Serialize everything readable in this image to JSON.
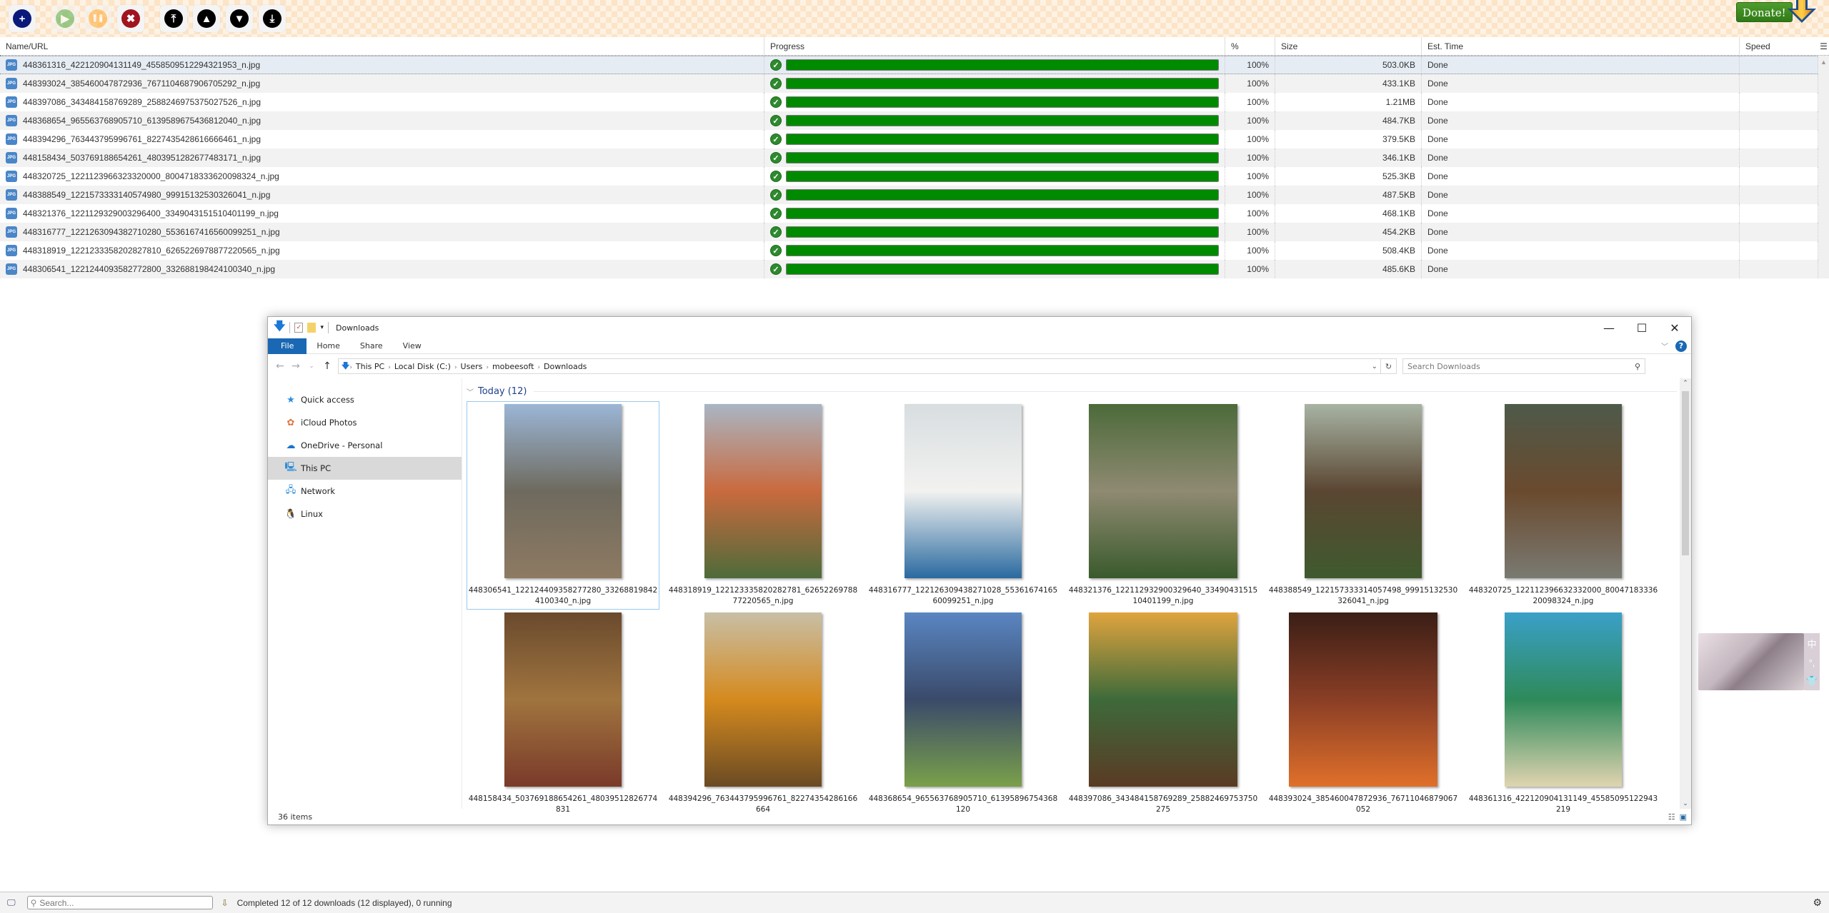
{
  "toolbar": {
    "buttons": [
      {
        "name": "add",
        "icon": "plus-icon",
        "color": "#0a1a7a",
        "glyph": "+",
        "enabled": true
      },
      {
        "name": "start",
        "icon": "play-icon",
        "color": "#3da83d",
        "glyph": "▶",
        "enabled": false
      },
      {
        "name": "pause",
        "icon": "pause-icon",
        "color": "#ffa21f",
        "glyph": "❚❚",
        "enabled": false
      },
      {
        "name": "delete",
        "icon": "x-icon",
        "color": "#a0141e",
        "glyph": "✖",
        "enabled": true
      },
      {
        "name": "move-top",
        "icon": "move-top-icon",
        "color": "#000000",
        "glyph": "⤒",
        "enabled": true
      },
      {
        "name": "move-up",
        "icon": "move-up-icon",
        "color": "#000000",
        "glyph": "▲",
        "enabled": true
      },
      {
        "name": "move-down",
        "icon": "move-down-icon",
        "color": "#000000",
        "glyph": "▼",
        "enabled": true
      },
      {
        "name": "move-bottom",
        "icon": "move-bottom-icon",
        "color": "#000000",
        "glyph": "⤓",
        "enabled": true
      }
    ],
    "donate_label": "Donate!"
  },
  "grid": {
    "columns": {
      "name": "Name/URL",
      "progress": "Progress",
      "percent": "%",
      "size": "Size",
      "est_time": "Est. Time",
      "speed": "Speed"
    },
    "rows": [
      {
        "name": "448361316_422120904131149_4558509512294321953_n.jpg",
        "progress": 1.0,
        "percent": "100%",
        "size": "503.0KB",
        "est_time": "Done",
        "speed": "",
        "selected": true
      },
      {
        "name": "448393024_385460047872936_7671104687906705292_n.jpg",
        "progress": 1.0,
        "percent": "100%",
        "size": "433.1KB",
        "est_time": "Done",
        "speed": ""
      },
      {
        "name": "448397086_343484158769289_2588246975375027526_n.jpg",
        "progress": 1.0,
        "percent": "100%",
        "size": "1.21MB",
        "est_time": "Done",
        "speed": ""
      },
      {
        "name": "448368654_965563768905710_6139589675436812040_n.jpg",
        "progress": 1.0,
        "percent": "100%",
        "size": "484.7KB",
        "est_time": "Done",
        "speed": ""
      },
      {
        "name": "448394296_763443795996761_8227435428616666461_n.jpg",
        "progress": 1.0,
        "percent": "100%",
        "size": "379.5KB",
        "est_time": "Done",
        "speed": ""
      },
      {
        "name": "448158434_503769188654261_4803951282677483171_n.jpg",
        "progress": 1.0,
        "percent": "100%",
        "size": "346.1KB",
        "est_time": "Done",
        "speed": ""
      },
      {
        "name": "448320725_1221123966323320000_8004718333620098324_n.jpg",
        "progress": 1.0,
        "percent": "100%",
        "size": "525.3KB",
        "est_time": "Done",
        "speed": ""
      },
      {
        "name": "448388549_1221573333140574980_99915132530326041_n.jpg",
        "progress": 1.0,
        "percent": "100%",
        "size": "487.5KB",
        "est_time": "Done",
        "speed": ""
      },
      {
        "name": "448321376_1221129329003296400_3349043151510401199_n.jpg",
        "progress": 1.0,
        "percent": "100%",
        "size": "468.1KB",
        "est_time": "Done",
        "speed": ""
      },
      {
        "name": "448316777_1221263094382710280_5536167416560099251_n.jpg",
        "progress": 1.0,
        "percent": "100%",
        "size": "454.2KB",
        "est_time": "Done",
        "speed": ""
      },
      {
        "name": "448318919_1221233358202827810_6265226978877220565_n.jpg",
        "progress": 1.0,
        "percent": "100%",
        "size": "508.4KB",
        "est_time": "Done",
        "speed": ""
      },
      {
        "name": "448306541_1221244093582772800_332688198424100340_n.jpg",
        "progress": 1.0,
        "percent": "100%",
        "size": "485.6KB",
        "est_time": "Done",
        "speed": ""
      }
    ]
  },
  "explorer": {
    "title": "Downloads",
    "ribbon_tabs": [
      "File",
      "Home",
      "Share",
      "View"
    ],
    "breadcrumb": [
      "This PC",
      "Local Disk (C:)",
      "Users",
      "mobeesoft",
      "Downloads"
    ],
    "search_placeholder": "Search Downloads",
    "nav": [
      {
        "label": "Quick access",
        "icon": "star-icon",
        "glyph": "★",
        "color": "#2b8be0"
      },
      {
        "label": "iCloud Photos",
        "icon": "icloud-photos-icon",
        "glyph": "✿",
        "color": "#e0743a"
      },
      {
        "label": "OneDrive - Personal",
        "icon": "onedrive-icon",
        "glyph": "☁",
        "color": "#1a73c9"
      },
      {
        "label": "This PC",
        "icon": "computer-icon",
        "glyph": "🖳",
        "color": "#2a8ad8",
        "selected": true
      },
      {
        "label": "Network",
        "icon": "network-icon",
        "glyph": "🖧",
        "color": "#2a8ad8"
      },
      {
        "label": "Linux",
        "icon": "linux-penguin-icon",
        "glyph": "🐧",
        "color": "#333333"
      }
    ],
    "group_label": "Today (12)",
    "files": [
      {
        "label": "448306541_122124409358277280_332688198424100340_n.jpg",
        "colors": [
          "#9bb6d6",
          "#6e6a5e",
          "#8e7a62"
        ],
        "selected": true
      },
      {
        "label": "448318919_122123335820282781_6265226978877220565_n.jpg",
        "colors": [
          "#a9b6c4",
          "#c96a3e",
          "#4e6b3a"
        ]
      },
      {
        "label": "448316777_122126309438271028_5536167416560099251_n.jpg",
        "colors": [
          "#d8dde0",
          "#f2f2f0",
          "#2a6aa0"
        ]
      },
      {
        "label": "448321376_122112932900329640_3349043151510401199_n.jpg",
        "colors": [
          "#4c6a3a",
          "#8f8a72",
          "#3a5a2c"
        ]
      },
      {
        "label": "448388549_122157333314057498_99915132530326041_n.jpg",
        "colors": [
          "#a8b4a4",
          "#5a4632",
          "#3f5a2e"
        ]
      },
      {
        "label": "448320725_122112396632332000_8004718333620098324_n.jpg",
        "colors": [
          "#4e5a4a",
          "#6a4a2e",
          "#7a7a72"
        ]
      },
      {
        "label": "448158434_503769188654261_48039512826774831",
        "colors": [
          "#6a4a2e",
          "#a0743e",
          "#7a3a2a"
        ]
      },
      {
        "label": "448394296_763443795996761_82274354286166664",
        "colors": [
          "#c8bfa6",
          "#d58a1e",
          "#6a4a24"
        ]
      },
      {
        "label": "448368654_965563768905710_61395896754368120",
        "colors": [
          "#5a86c2",
          "#3a4a6a",
          "#7aa04a"
        ]
      },
      {
        "label": "448397086_343484158769289_25882469753750275",
        "colors": [
          "#e0a43e",
          "#3e6a3a",
          "#5a3a24"
        ]
      },
      {
        "label": "448393024_385460047872936_76711046879067052",
        "colors": [
          "#3a1e16",
          "#8a3e26",
          "#e0702a"
        ]
      },
      {
        "label": "448361316_422120904131149_45585095122943219",
        "colors": [
          "#3aa0c8",
          "#2e8a5a",
          "#e0d4b0"
        ]
      }
    ],
    "item_count": "36 items"
  },
  "widget": {
    "glyphs": [
      "中",
      "°,",
      "👕"
    ]
  },
  "statusbar": {
    "search_placeholder": "Search...",
    "status_text": "Completed 12 of 12 downloads (12 displayed), 0 running"
  }
}
